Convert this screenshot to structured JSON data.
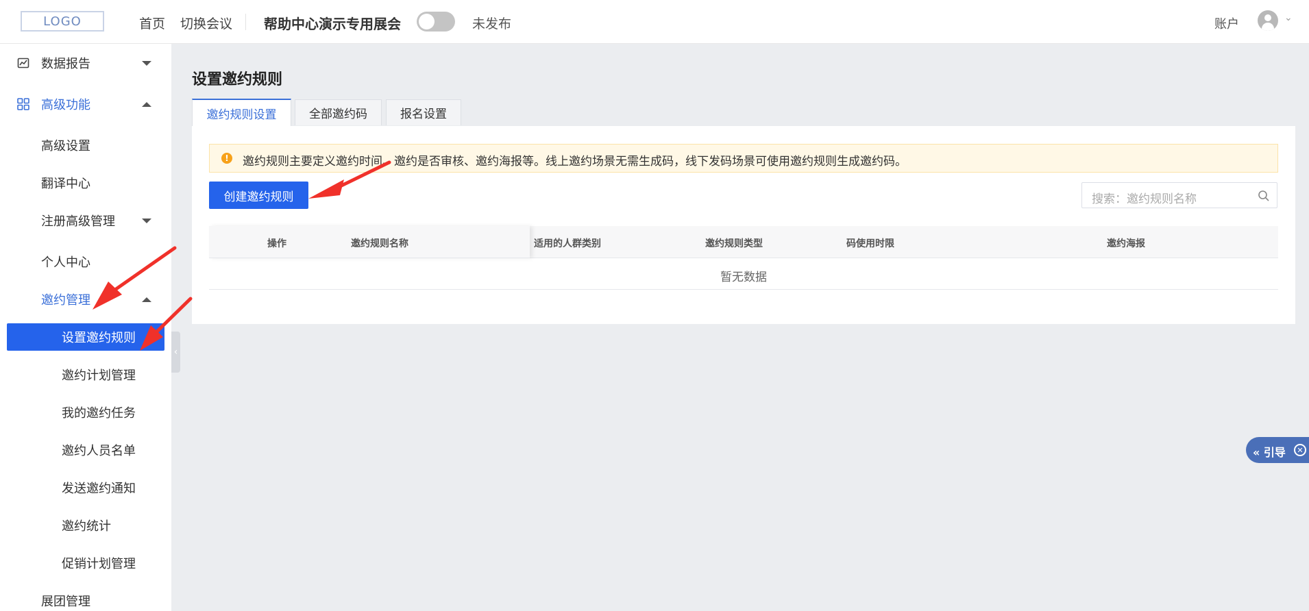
{
  "header": {
    "logo": "LOGO",
    "nav_home": "首页",
    "nav_switch": "切换会议",
    "event_title": "帮助中心演示专用展会",
    "publish_status": "未发布",
    "account": "账户"
  },
  "sidebar": {
    "items": [
      {
        "label": "数据报告",
        "icon": "chart-icon",
        "caret": "down"
      },
      {
        "label": "高级功能",
        "icon": "grid-icon",
        "caret": "up"
      },
      {
        "label": "高级设置"
      },
      {
        "label": "翻译中心"
      },
      {
        "label": "注册高级管理",
        "caret": "down"
      },
      {
        "label": "个人中心"
      },
      {
        "label": "邀约管理",
        "caret": "up"
      },
      {
        "label": "设置邀约规则",
        "active": true
      },
      {
        "label": "邀约计划管理"
      },
      {
        "label": "我的邀约任务"
      },
      {
        "label": "邀约人员名单"
      },
      {
        "label": "发送邀约通知"
      },
      {
        "label": "邀约统计"
      },
      {
        "label": "促销计划管理"
      },
      {
        "label": "展团管理"
      }
    ]
  },
  "main": {
    "title": "设置邀约规则",
    "tabs": [
      "邀约规则设置",
      "全部邀约码",
      "报名设置"
    ],
    "notice": "邀约规则主要定义邀约时间、邀约是否审核、邀约海报等。线上邀约场景无需生成码，线下发码场景可使用邀约规则生成邀约码。",
    "create_button": "创建邀约规则",
    "search_placeholder": "搜索：邀约规则名称",
    "table": {
      "columns": [
        "操作",
        "邀约规则名称",
        "适用的人群类别",
        "邀约规则类型",
        "码使用时限",
        "邀约海报"
      ],
      "empty_text": "暂无数据"
    }
  },
  "guide": {
    "label": "« 引导"
  },
  "colors": {
    "primary": "#2563eb",
    "accent_text": "#3a6fd8",
    "notice_bg": "#fff8e6",
    "annotation_arrow": "#f0312a"
  }
}
